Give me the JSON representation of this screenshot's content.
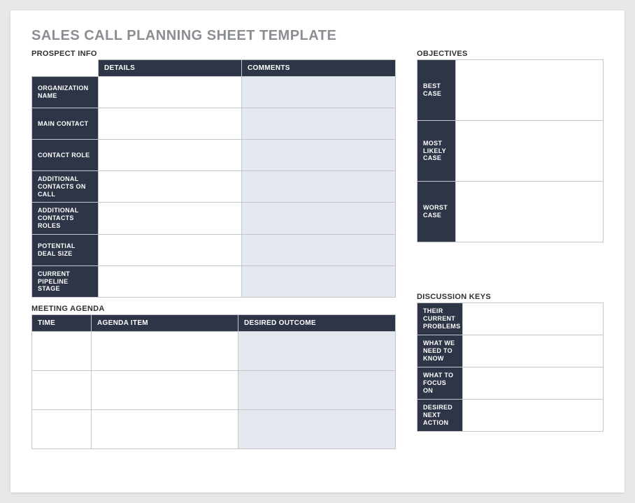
{
  "title": "SALES CALL PLANNING SHEET TEMPLATE",
  "prospect": {
    "section_label": "PROSPECT INFO",
    "headers": {
      "details": "DETAILS",
      "comments": "COMMENTS"
    },
    "rows": [
      {
        "label": "ORGANIZATION NAME",
        "details": "",
        "comments": ""
      },
      {
        "label": "MAIN CONTACT",
        "details": "",
        "comments": ""
      },
      {
        "label": "CONTACT ROLE",
        "details": "",
        "comments": ""
      },
      {
        "label": "ADDITIONAL CONTACTS ON CALL",
        "details": "",
        "comments": ""
      },
      {
        "label": "ADDITIONAL CONTACTS ROLES",
        "details": "",
        "comments": ""
      },
      {
        "label": "POTENTIAL DEAL SIZE",
        "details": "",
        "comments": ""
      },
      {
        "label": "CURRENT PIPELINE STAGE",
        "details": "",
        "comments": ""
      }
    ]
  },
  "agenda": {
    "section_label": "MEETING AGENDA",
    "headers": {
      "time": "TIME",
      "item": "AGENDA ITEM",
      "outcome": "DESIRED OUTCOME"
    },
    "rows": [
      {
        "time": "",
        "item": "",
        "outcome": ""
      },
      {
        "time": "",
        "item": "",
        "outcome": ""
      },
      {
        "time": "",
        "item": "",
        "outcome": ""
      }
    ]
  },
  "objectives": {
    "section_label": "OBJECTIVES",
    "rows": [
      {
        "label": "BEST CASE",
        "value": ""
      },
      {
        "label": "MOST LIKELY CASE",
        "value": ""
      },
      {
        "label": "WORST CASE",
        "value": ""
      }
    ]
  },
  "discussion": {
    "section_label": "DISCUSSION KEYS",
    "rows": [
      {
        "label": "THEIR CURRENT PROBLEMS",
        "value": ""
      },
      {
        "label": "WHAT WE NEED TO KNOW",
        "value": ""
      },
      {
        "label": "WHAT TO FOCUS ON",
        "value": ""
      },
      {
        "label": "DESIRED NEXT ACTION",
        "value": ""
      }
    ]
  }
}
